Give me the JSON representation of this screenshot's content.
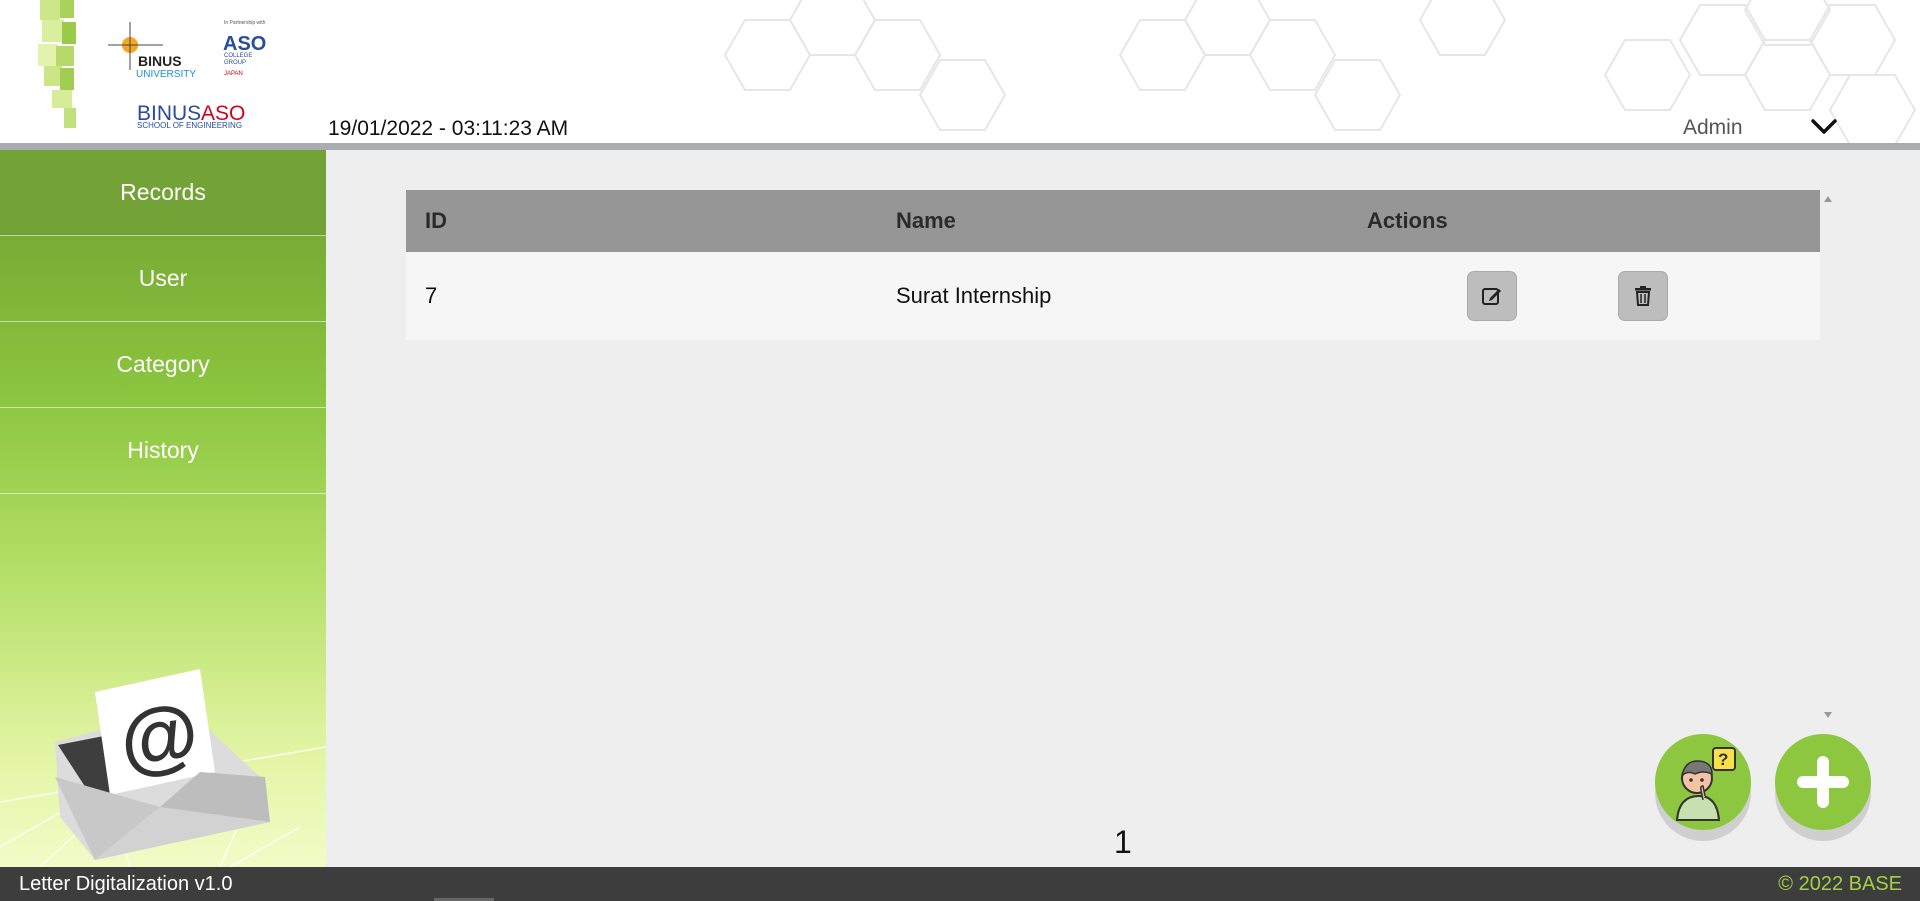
{
  "header": {
    "logo_binus_university": "BINUS UNIVERSITY",
    "logo_aso_partner": "In Partnership with ASO COLLEGE GROUP JAPAN",
    "logo_binus_aso": "BINUS ASO SCHOOL OF ENGINEERING",
    "datetime": "19/01/2022 - 03:11:23 AM",
    "user_name": "Admin",
    "user_menu_icon": "chevron-down-icon"
  },
  "sidebar": {
    "items": [
      {
        "label": "Records",
        "active": true
      },
      {
        "label": "User",
        "active": false
      },
      {
        "label": "Category",
        "active": false
      },
      {
        "label": "History",
        "active": false
      }
    ],
    "illustration": "envelope-at-icon"
  },
  "table": {
    "columns": [
      "ID",
      "Name",
      "Actions"
    ],
    "rows": [
      {
        "id": "7",
        "name": "Surat Internship",
        "actions": [
          "edit-icon",
          "trash-icon"
        ]
      }
    ]
  },
  "pagination": {
    "current_page": "1"
  },
  "fabs": {
    "help_icon": "help-person-icon",
    "add_icon": "plus-icon"
  },
  "footer": {
    "app_version": "Letter Digitalization v1.0",
    "copyright": "© 2022 BASE"
  },
  "colors": {
    "accent_green": "#8cc63f",
    "table_header": "#969696",
    "footer_bg": "#3d3d3d",
    "footer_copyright": "#a3cf47"
  }
}
